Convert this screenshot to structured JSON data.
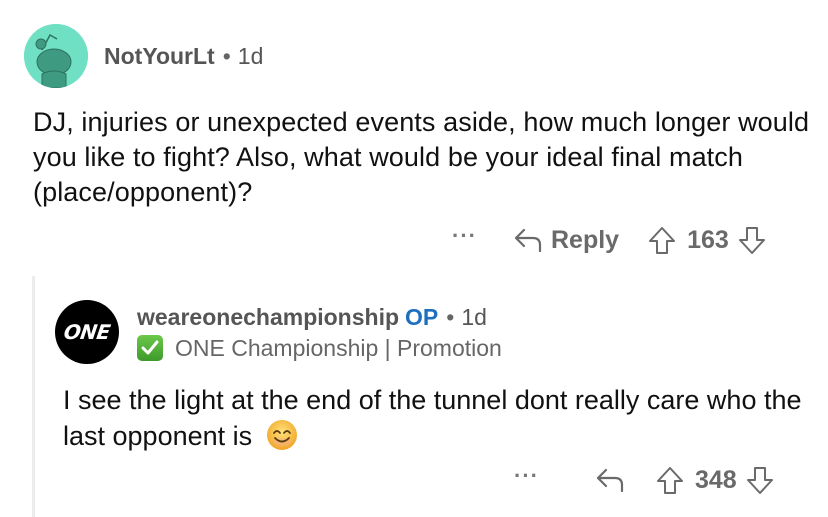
{
  "parent_comment": {
    "avatar": "reddit-snoo-avatar-icon",
    "avatar_color": "#6fe0c3",
    "username": "NotYourLt",
    "separator": "•",
    "age": "1d",
    "body": "DJ, injuries or unexpected events aside, how much longer would you like to fight? Also, what would be your ideal final match (place/opponent)?",
    "actions": {
      "more_label": "···",
      "reply_label": "Reply",
      "score": "163"
    }
  },
  "reply_comment": {
    "avatar_text": "ONE",
    "username": "weareonechampionship",
    "op_label": "OP",
    "op_color": "#1f6fbe",
    "separator": "•",
    "age": "1d",
    "flair": "ONE Championship | Promotion",
    "flair_icon": "check-mark-button-emoji",
    "body": "I see the light at the end of the tunnel dont really care who the last opponent is",
    "emoji": "smiling-face-with-smiling-eyes",
    "actions": {
      "more_label": "···",
      "score": "348"
    }
  }
}
